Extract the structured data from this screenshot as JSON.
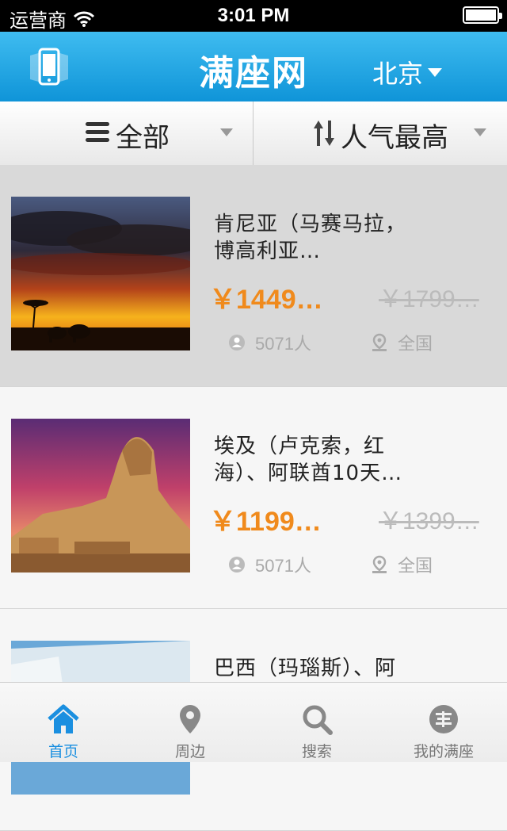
{
  "status": {
    "carrier": "运营商",
    "time": "3:01 PM"
  },
  "nav": {
    "title": "满座网",
    "city": "北京"
  },
  "filters": {
    "category": "全部",
    "sort": "人气最高"
  },
  "items": [
    {
      "title": "肯尼亚（马赛马拉，博高利亚…",
      "price": "￥1449…",
      "old_price": "￥1799…",
      "people": "5071人",
      "area": "全国"
    },
    {
      "title": "埃及（卢克索，红海）、阿联酋10天…",
      "price": "￥1199…",
      "old_price": "￥1399…",
      "people": "5071人",
      "area": "全国"
    },
    {
      "title": "巴西（玛瑙斯）、阿",
      "price": "",
      "old_price": "",
      "people": "",
      "area": ""
    }
  ],
  "tabs": [
    {
      "label": "首页",
      "icon": "home-icon",
      "active": true
    },
    {
      "label": "周边",
      "icon": "location-pin-icon",
      "active": false
    },
    {
      "label": "搜索",
      "icon": "search-icon",
      "active": false
    },
    {
      "label": "我的满座",
      "icon": "profile-badge-icon",
      "active": false
    }
  ],
  "colors": {
    "accent": "#1a8fe0",
    "price": "#f08a1c",
    "navbar": "#29a9e8"
  }
}
